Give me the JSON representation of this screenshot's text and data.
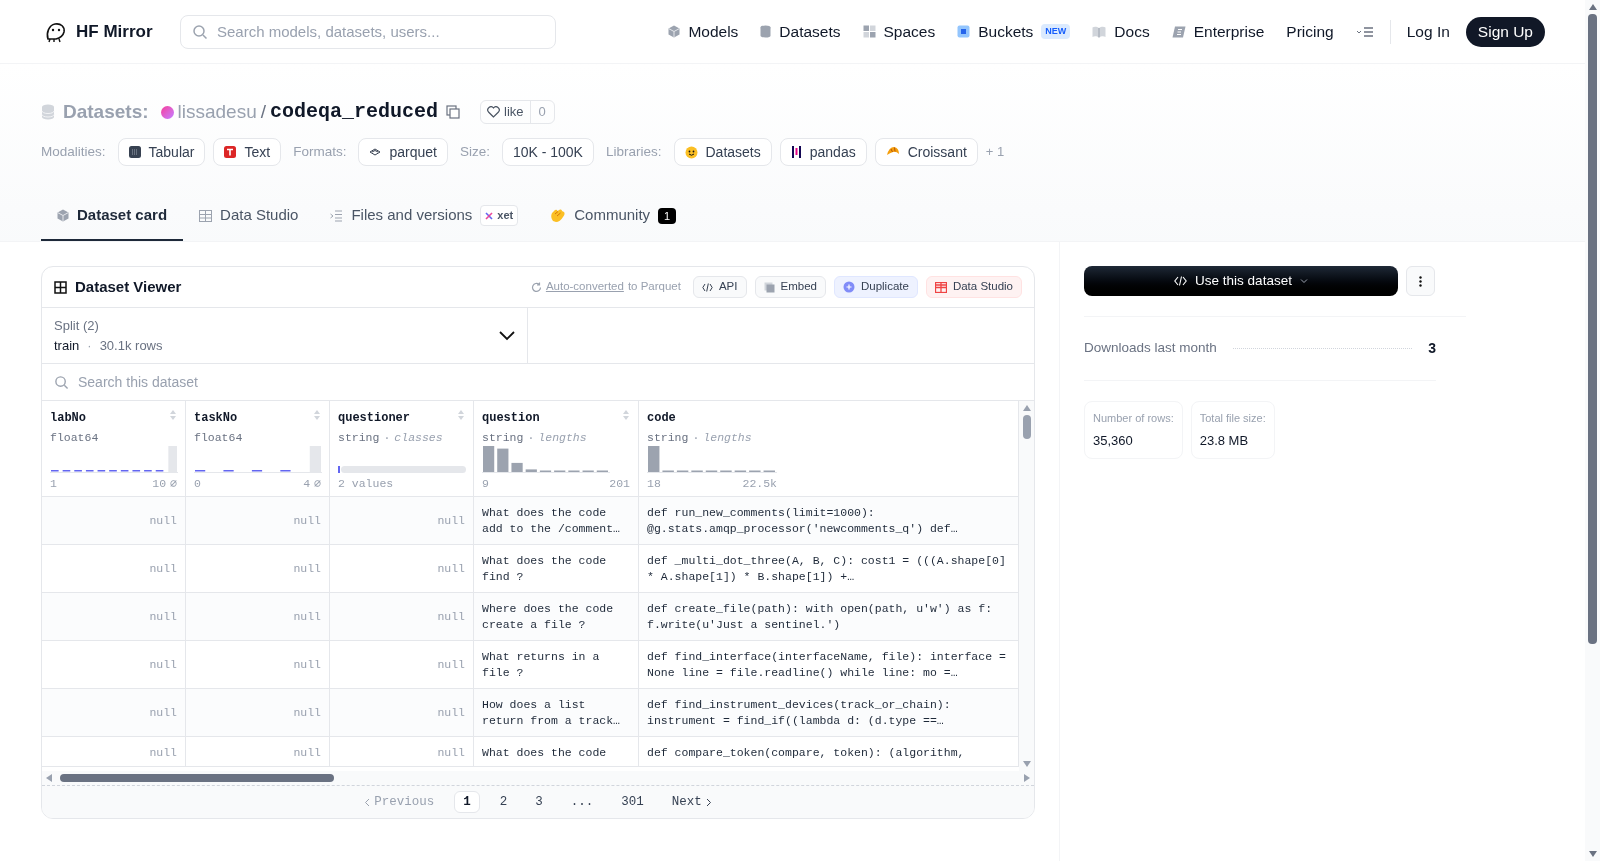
{
  "header": {
    "logo": "HF Mirror",
    "search_placeholder": "Search models, datasets, users...",
    "nav": [
      {
        "label": "Models"
      },
      {
        "label": "Datasets"
      },
      {
        "label": "Spaces"
      },
      {
        "label": "Buckets",
        "badge": "NEW"
      },
      {
        "label": "Docs"
      },
      {
        "label": "Enterprise"
      },
      {
        "label": "Pricing"
      }
    ],
    "login": "Log In",
    "signup": "Sign Up"
  },
  "dataset": {
    "prefix": "Datasets:",
    "owner": "lissadesu",
    "separator": "/",
    "name": "codeqa_reduced",
    "like_label": "like",
    "likes": "0"
  },
  "tag_groups": [
    {
      "label": "Modalities:",
      "items": [
        "Tabular",
        "Text"
      ]
    },
    {
      "label": "Formats:",
      "items": [
        "parquet"
      ]
    },
    {
      "label": "Size:",
      "items": [
        "10K - 100K"
      ]
    },
    {
      "label": "Libraries:",
      "items": [
        "Datasets",
        "pandas",
        "Croissant"
      ],
      "more": "+ 1"
    }
  ],
  "tabs": [
    {
      "label": "Dataset card",
      "selected": true
    },
    {
      "label": "Data Studio",
      "selected": false
    },
    {
      "label": "Files and versions",
      "badge": "xet",
      "selected": false
    },
    {
      "label": "Community",
      "count": "1",
      "selected": false
    }
  ],
  "viewer": {
    "title": "Dataset Viewer",
    "converted_link": "Auto-converted",
    "converted_rest": "to Parquet",
    "actions": [
      {
        "label": "API",
        "kind": "api"
      },
      {
        "label": "Embed",
        "kind": "embed"
      },
      {
        "label": "Duplicate",
        "kind": "duplicate"
      },
      {
        "label": "Data Studio",
        "kind": "studio"
      }
    ],
    "split": {
      "label": "Split (2)",
      "name": "train",
      "separator": "·",
      "rows": "30.1k rows"
    },
    "search_placeholder": "Search this dataset",
    "columns": [
      {
        "name": "labNo",
        "type": "float64",
        "min": "1",
        "max": "10",
        "null_mark": "⌀"
      },
      {
        "name": "taskNo",
        "type": "float64",
        "min": "0",
        "max": "4",
        "null_mark": "⌀"
      },
      {
        "name": "questioner",
        "type": "string",
        "separator": "·",
        "stat": "classes",
        "footer": "2 values"
      },
      {
        "name": "question",
        "type": "string",
        "separator": "·",
        "stat": "lengths",
        "min": "9",
        "max": "201"
      },
      {
        "name": "code",
        "type": "string",
        "separator": "·",
        "stat": "lengths",
        "min": "18",
        "max": "22.5k"
      }
    ],
    "rows": [
      [
        "null",
        "null",
        "null",
        "What does the code add to the /comment…",
        "def run_new_comments(limit=1000): @g.stats.amqp_processor('newcomments_q') def…"
      ],
      [
        "null",
        "null",
        "null",
        "What does the code find ?",
        "def _multi_dot_three(A, B, C): cost1 = (((A.shape[0] * A.shape[1]) * B.shape[1]) +…"
      ],
      [
        "null",
        "null",
        "null",
        "Where does the code create a file ?",
        "def create_file(path): with open(path, u'w') as f: f.write(u'Just a sentinel.')"
      ],
      [
        "null",
        "null",
        "null",
        "What returns in a file ?",
        "def find_interface(interfaceName, file): interface = None line = file.readline() while line: mo =…"
      ],
      [
        "null",
        "null",
        "null",
        "How does a list return from a track…",
        "def find_instrument_devices(track_or_chain): instrument = find_if((lambda d: (d.type ==…"
      ],
      [
        "null",
        "null",
        "null",
        "What does the code",
        "def compare_token(compare, token): (algorithm,"
      ]
    ],
    "pagination": {
      "previous": "Previous",
      "pages": [
        {
          "label": "1",
          "selected": true
        },
        {
          "label": "2",
          "selected": false
        },
        {
          "label": "3",
          "selected": false
        },
        {
          "label": "...",
          "selected": false
        },
        {
          "label": "301",
          "selected": false
        }
      ],
      "next": "Next"
    }
  },
  "sidebar": {
    "use_button": "Use this dataset",
    "downloads_label": "Downloads last month",
    "downloads": "3",
    "stats": [
      {
        "label": "Number of rows:",
        "value": "35,360"
      },
      {
        "label": "Total file size:",
        "value": "23.8 MB"
      }
    ]
  }
}
